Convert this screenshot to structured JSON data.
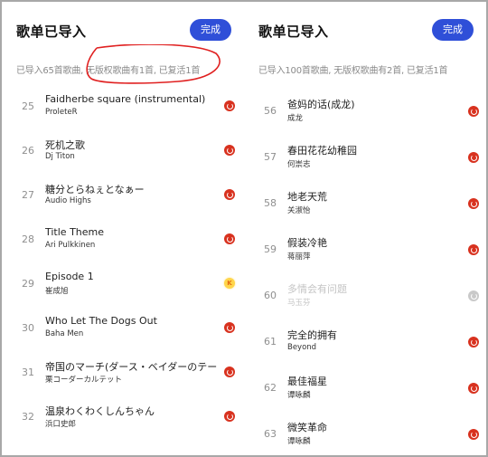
{
  "left_panel": {
    "title": "歌单已导入",
    "done_label": "完成",
    "summary": "已导入65首歌曲, 无版权歌曲有1首, 已复活1首",
    "songs": [
      {
        "index": "25",
        "title": "Faidherbe square (instrumental)",
        "artist": "ProleteR",
        "source_icon": "netease-icon",
        "available": true
      },
      {
        "index": "26",
        "title": "死机之歌",
        "artist": "Dj Titon",
        "source_icon": "netease-icon",
        "available": true
      },
      {
        "index": "27",
        "title": "糖分とらねぇとなぁー",
        "artist": "Audio Highs",
        "source_icon": "netease-icon",
        "available": true
      },
      {
        "index": "28",
        "title": "Title Theme",
        "artist": "Ari Pulkkinen",
        "source_icon": "netease-icon",
        "available": true
      },
      {
        "index": "29",
        "title": "Episode 1",
        "artist": "崔成旭",
        "source_icon": "kugou-icon",
        "available": true
      },
      {
        "index": "30",
        "title": "Who Let The Dogs Out",
        "artist": "Baha Men",
        "source_icon": "netease-icon",
        "available": true
      },
      {
        "index": "31",
        "title": "帝国のマーチ(ダース・ベイダーのテー...",
        "artist": "栗コーダーカルテット",
        "source_icon": "netease-icon",
        "available": true
      },
      {
        "index": "32",
        "title": "温泉わくわくしんちゃん",
        "artist": "浜口史郎",
        "source_icon": "netease-icon",
        "available": true
      }
    ]
  },
  "right_panel": {
    "title": "歌单已导入",
    "done_label": "完成",
    "summary": "已导入100首歌曲, 无版权歌曲有2首, 已复活1首",
    "songs": [
      {
        "index": "56",
        "title": "爸妈的话(成龙)",
        "artist": "成龙",
        "source_icon": "netease-icon",
        "available": true
      },
      {
        "index": "57",
        "title": "春田花花幼稚园",
        "artist": "何崇志",
        "source_icon": "netease-icon",
        "available": true
      },
      {
        "index": "58",
        "title": "地老天荒",
        "artist": "关淑怡",
        "source_icon": "netease-icon",
        "available": true
      },
      {
        "index": "59",
        "title": "假装冷艳",
        "artist": "蒋丽萍",
        "source_icon": "netease-icon",
        "available": true
      },
      {
        "index": "60",
        "title": "多情会有问题",
        "artist": "马玉芬",
        "source_icon": "unavailable-icon",
        "available": false
      },
      {
        "index": "61",
        "title": "完全的拥有",
        "artist": "Beyond",
        "source_icon": "netease-icon",
        "available": true
      },
      {
        "index": "62",
        "title": "最佳福星",
        "artist": "谭咏麟",
        "source_icon": "netease-icon",
        "available": true
      },
      {
        "index": "63",
        "title": "微笑革命",
        "artist": "谭咏麟",
        "source_icon": "netease-icon",
        "available": true
      }
    ]
  },
  "icons": {
    "kugou_glyph": "K"
  },
  "colors": {
    "accent": "#2f4fd8",
    "netease_red": "#d8321f",
    "kugou_yellow": "#ffd54a",
    "annotation_red": "#e02020"
  }
}
